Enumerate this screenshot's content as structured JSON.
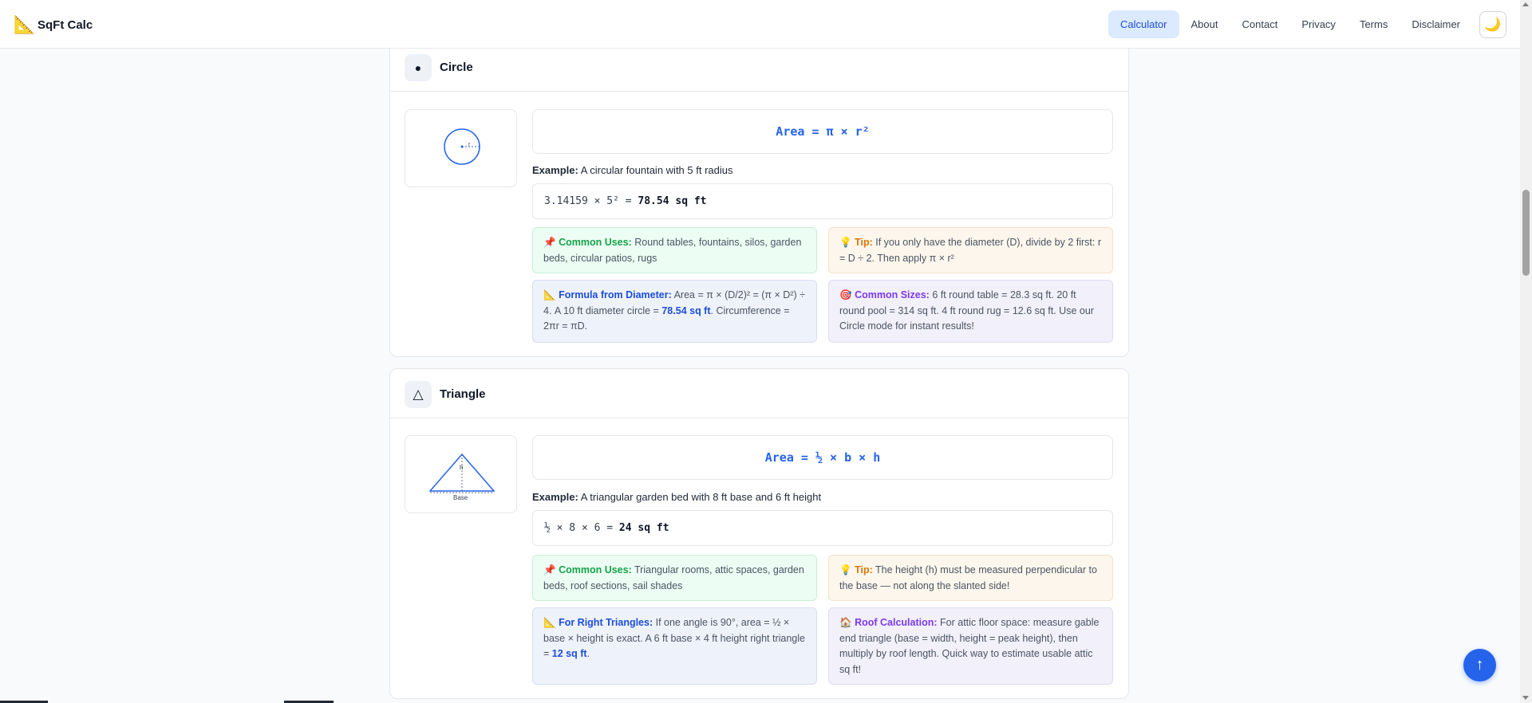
{
  "nav": {
    "brand_icon": "📐",
    "brand": "SqFt Calc",
    "links": [
      "Calculator",
      "About",
      "Contact",
      "Privacy",
      "Terms",
      "Disclaimer"
    ],
    "active": "Calculator",
    "theme_icon": "🌙"
  },
  "circle": {
    "icon": "●",
    "title": "Circle",
    "diagram_label": "r",
    "formula": "Area = π × r²",
    "example_label": "Example:",
    "example_text": "A circular fountain with 5 ft radius",
    "calc_expr": "3.14159 × 5² =",
    "calc_result": "78.54 sq ft",
    "uses_icon": "📌",
    "uses_label": "Common Uses:",
    "uses_text": "Round tables, fountains, silos, garden beds, circular patios, rugs",
    "tip_icon": "💡",
    "tip_label": "Tip:",
    "tip_text": "If you only have the diameter (D), divide by 2 first: r = D ÷ 2. Then apply π × r²",
    "diam_icon": "📐",
    "diam_label": "Formula from Diameter:",
    "diam_text_1": "Area = π × (D/2)² = (π × D²) ÷ 4. A 10 ft diameter circle =",
    "diam_highlight": "78.54 sq ft",
    "diam_text_2": ". Circumference = 2πr = πD.",
    "sizes_icon": "🎯",
    "sizes_label": "Common Sizes:",
    "sizes_text": "6 ft round table = 28.3 sq ft. 20 ft round pool = 314 sq ft. 4 ft round rug = 12.6 sq ft. Use our Circle mode for instant results!"
  },
  "triangle": {
    "icon": "△",
    "title": "Triangle",
    "diagram_h": "h",
    "diagram_base": "Base",
    "formula": "Area = ½ × b × h",
    "example_label": "Example:",
    "example_text": "A triangular garden bed with 8 ft base and 6 ft height",
    "calc_expr": "½ × 8 × 6 =",
    "calc_result": "24 sq ft",
    "uses_icon": "📌",
    "uses_label": "Common Uses:",
    "uses_text": "Triangular rooms, attic spaces, garden beds, roof sections, sail shades",
    "tip_icon": "💡",
    "tip_label": "Tip:",
    "tip_text": "The height (h) must be measured perpendicular to the base — not along the slanted side!",
    "right_icon": "📐",
    "right_label": "For Right Triangles:",
    "right_text_1": "If one angle is 90°, area = ½ × base × height is exact. A 6 ft base × 4 ft height right triangle =",
    "right_highlight": "12 sq ft",
    "right_text_2": ".",
    "roof_icon": "🏠",
    "roof_label": "Roof Calculation:",
    "roof_text": "For attic floor space: measure gable end triangle (base = width, height = peak height), then multiply by roof length. Quick way to estimate usable attic sq ft!"
  },
  "back_to_top_icon": "↑"
}
